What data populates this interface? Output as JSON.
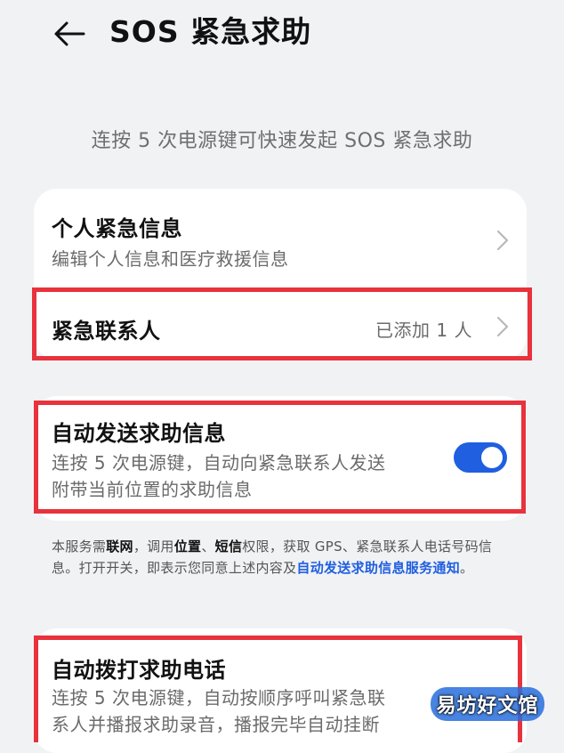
{
  "header": {
    "title": "SOS 紧急求助"
  },
  "subtitle": "连按 5 次电源键可快速发起 SOS 紧急求助",
  "card1": {
    "personal_title": "个人紧急信息",
    "personal_sub": "编辑个人信息和医疗救援信息",
    "contacts_title": "紧急联系人",
    "contacts_value": "已添加 1 人"
  },
  "card2": {
    "title": "自动发送求助信息",
    "sub_line1": "连按 5 次电源键，自动向紧急联系人发送",
    "sub_line2": "附带当前位置的求助信息",
    "toggle_on": true
  },
  "notice": {
    "p1": "本服务需",
    "b1": "联网",
    "p2": "，调用",
    "b2": "位置",
    "p3": "、",
    "b3": "短信",
    "p4": "权限，获取 GPS、紧急联系人电话号码信息。打开开关，即表示您同意上述内容及",
    "link": "自动发送求助信息服务通知",
    "p5": "。"
  },
  "card3": {
    "title": "自动拨打求助电话",
    "sub_line1": "连按 5 次电源键，自动按顺序呼叫紧急联",
    "sub_line2": "系人并播报求助录音，播报完毕自动挂断"
  },
  "watermark": "易坊好文馆",
  "colors": {
    "accent": "#1f5fe0",
    "highlight": "#e8323c",
    "background": "#f1f2f4"
  }
}
